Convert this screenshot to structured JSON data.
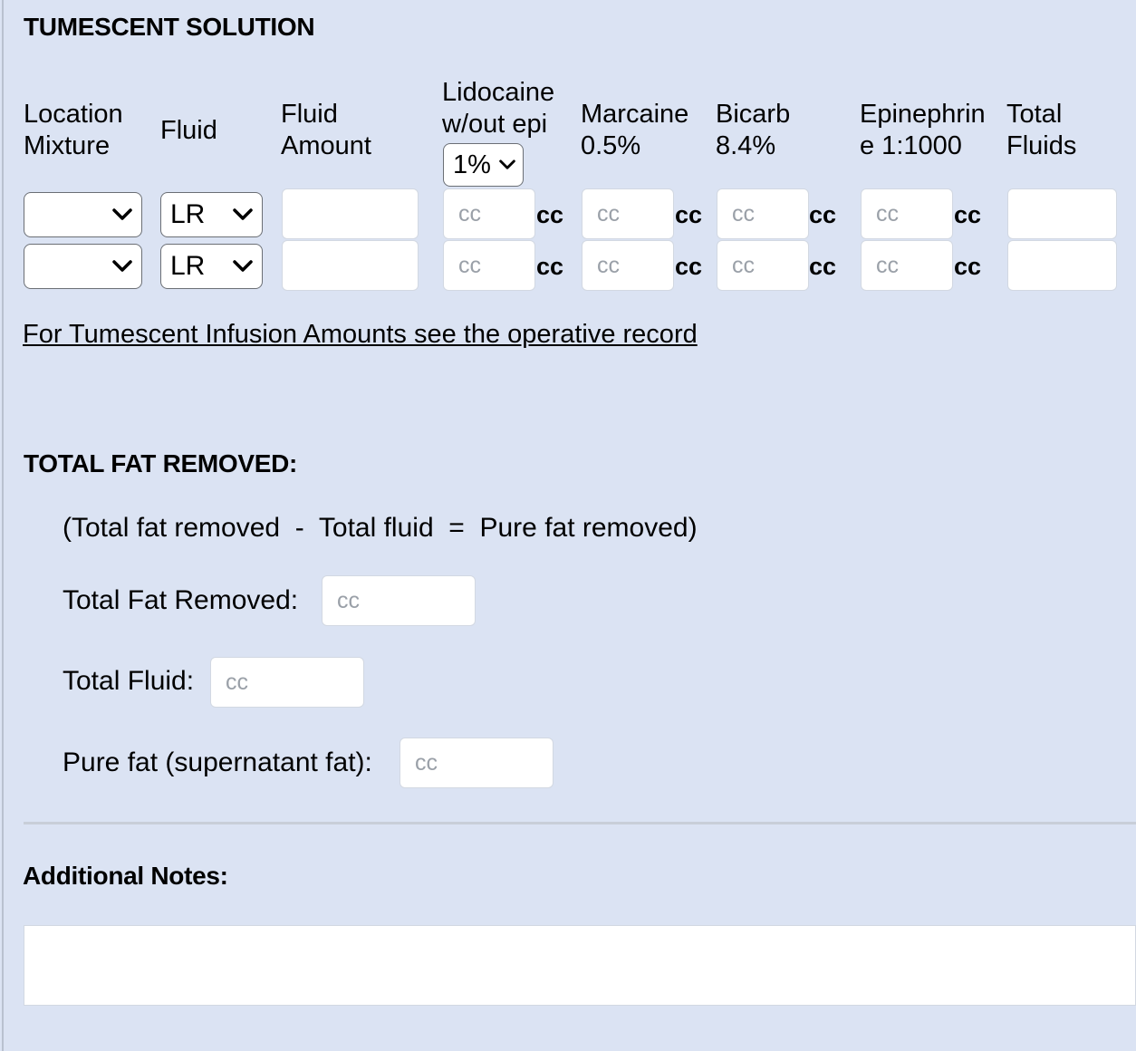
{
  "tumescent": {
    "title": "TUMESCENT SOLUTION",
    "headers": {
      "location_mixture": [
        "Location",
        "Mixture"
      ],
      "fluid": "Fluid",
      "fluid_amount": [
        "Fluid",
        "Amount"
      ],
      "lidocaine": [
        "Lidocaine",
        "w/out epi"
      ],
      "lidocaine_select": "1%",
      "marcaine": [
        "Marcaine",
        "0.5%"
      ],
      "bicarb": [
        "Bicarb",
        "8.4%"
      ],
      "epinephrine": [
        "Epinephrin",
        "e 1:1000"
      ],
      "total_fluids": [
        "Total",
        "Fluids"
      ]
    },
    "rows": [
      {
        "location": "",
        "fluid": "LR",
        "fluid_amount": "",
        "lidocaine": "",
        "marcaine": "",
        "bicarb": "",
        "epinephrine": "",
        "total": ""
      },
      {
        "location": "",
        "fluid": "LR",
        "fluid_amount": "",
        "lidocaine": "",
        "marcaine": "",
        "bicarb": "",
        "epinephrine": "",
        "total": ""
      }
    ],
    "placeholder_cc": "cc",
    "unit_label": "cc",
    "link_text": "For Tumescent Infusion Amounts see the operative record"
  },
  "fat": {
    "title": "TOTAL FAT REMOVED:",
    "formula": "(Total fat removed  -  Total fluid  =  Pure fat removed)",
    "total_fat_label": "Total Fat Removed:",
    "total_fluid_label": "Total Fluid:",
    "pure_fat_label": "Pure fat (supernatant fat):",
    "placeholder": "cc"
  },
  "notes": {
    "title": "Additional Notes:"
  }
}
